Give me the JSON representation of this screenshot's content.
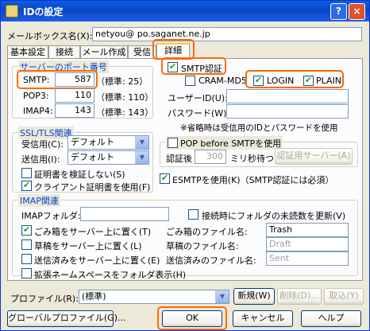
{
  "window": {
    "title": "IDの設定",
    "help_glyph": "?",
    "close_glyph": "×"
  },
  "mailbox": {
    "label": "メールボックス名(X):",
    "value": "netyou@ po.saganet.ne.jp"
  },
  "tabs": [
    {
      "label": "基本設定"
    },
    {
      "label": "接続"
    },
    {
      "label": "メール作成"
    },
    {
      "label": "受信"
    },
    {
      "label": "詳細"
    }
  ],
  "ports": {
    "title": "サーバーのポート番号",
    "rows": [
      {
        "label": "SMTP:",
        "value": "587",
        "note": "（標準: 25）"
      },
      {
        "label": "POP3:",
        "value": "110",
        "note": "（標準: 110）"
      },
      {
        "label": "IMAP4:",
        "value": "143",
        "note": "（標準: 143）"
      }
    ]
  },
  "smtp_auth": {
    "label": "SMTP認証",
    "checked": true,
    "cram": {
      "label": "CRAM-MD5",
      "checked": false
    },
    "login": {
      "label": "LOGIN",
      "checked": true
    },
    "plain": {
      "label": "PLAIN",
      "checked": true
    },
    "user_label": "ユーザーID(U):",
    "password_label": "パスワード(W):",
    "note": "※省略時は受信用のIDとパスワードを使用"
  },
  "ssl": {
    "title": "SSL/TLS関連",
    "recv_label": "受信用(C):",
    "recv_value": "デフォルト",
    "send_label": "送信用(I):",
    "send_value": "デフォルト",
    "verify_label": "証明書を検証しない(S)",
    "verify_checked": false,
    "client_cert_label": "クライアント証明書を使用(F)",
    "client_cert_checked": true
  },
  "pop_before": {
    "label": "POP before SMTPを使用",
    "checked": false,
    "auth_after_label": "認証後",
    "wait_value": "300",
    "wait_unit": "ミリ秒待つ",
    "server_button": "認証用サーバー(A)"
  },
  "esmtp": {
    "label": "ESMTPを使用(K)（SMTP認証には必須）",
    "checked": true
  },
  "imap": {
    "title": "IMAP関連",
    "folder_label": "IMAPフォルダ:",
    "update_unread_label": "接続時にフォルダの未読数を更新(V)",
    "update_unread_checked": false,
    "trash_on_server_label": "ごみ箱をサーバー上に置く(T)",
    "trash_on_server_checked": true,
    "draft_on_server_label": "草稿をサーバー上に置く(L)",
    "draft_on_server_checked": false,
    "sent_on_server_label": "送信済みをサーバー上に置く(E)",
    "sent_on_server_checked": false,
    "ext_namespace_label": "拡張ネームスペースをフォルダ表示(H)",
    "ext_namespace_checked": false,
    "trash_file_label": "ごみ箱のファイル名:",
    "trash_file_value": "Trash",
    "draft_file_label": "草稿のファイル名:",
    "draft_file_value": "Draft",
    "sent_file_label": "送信済みのファイル名:",
    "sent_file_value": "Sent"
  },
  "profile": {
    "label": "プロファイル(R):",
    "value": "(標準)",
    "new_button": "新規(W)",
    "delete_button": "削除(D)...",
    "import_button": "取込(Y)"
  },
  "footer": {
    "global_profile_button": "グローバルプロファイル(G)...",
    "ok_button": "OK",
    "cancel_button": "キャンセル",
    "help_button": "ヘルプ"
  },
  "colors": {
    "highlight": "#FF6A00",
    "group_title": "#0046D5",
    "title_bar": "#0A5FE0"
  }
}
